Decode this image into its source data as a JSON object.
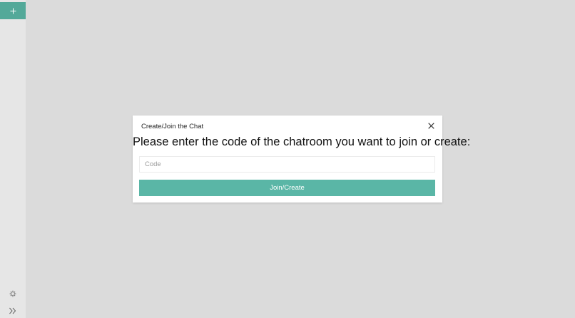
{
  "sidebar": {
    "add_icon": "plus-icon",
    "settings_icon": "gear-icon",
    "expand_icon": "double-chevron-right-icon",
    "accent_color": "#53a999"
  },
  "modal": {
    "title": "Create/Join the Chat",
    "close_icon": "close-icon",
    "prompt": "Please enter the code of the chatroom you want to join or create:",
    "code_input": {
      "value": "",
      "placeholder": "Code"
    },
    "submit_label": "Join/Create",
    "submit_color": "#5ab6a6"
  }
}
